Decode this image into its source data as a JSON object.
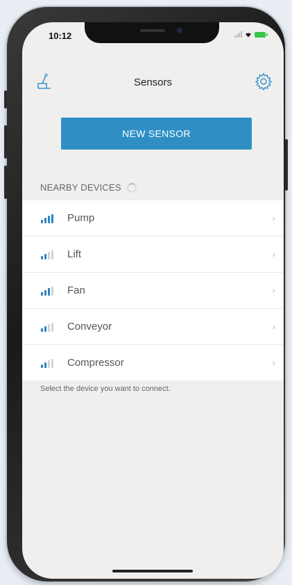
{
  "status_bar": {
    "time": "10:12"
  },
  "navbar": {
    "title": "Sensors",
    "left_icon": "scale-icon",
    "right_icon": "gear-icon"
  },
  "primary_button": {
    "label": "NEW SENSOR"
  },
  "section": {
    "title": "NEARBY DEVICES"
  },
  "devices": [
    {
      "name": "Pump",
      "signal_level": 4
    },
    {
      "name": "Lift",
      "signal_level": 2
    },
    {
      "name": "Fan",
      "signal_level": 3
    },
    {
      "name": "Conveyor",
      "signal_level": 2
    },
    {
      "name": "Compressor",
      "signal_level": 2
    }
  ],
  "hint": "Select the device you want to connect.",
  "colors": {
    "accent": "#2f8fc5",
    "signal_on": "#2a83c6",
    "signal_off": "#d3d3d3",
    "background": "#f1efed"
  }
}
